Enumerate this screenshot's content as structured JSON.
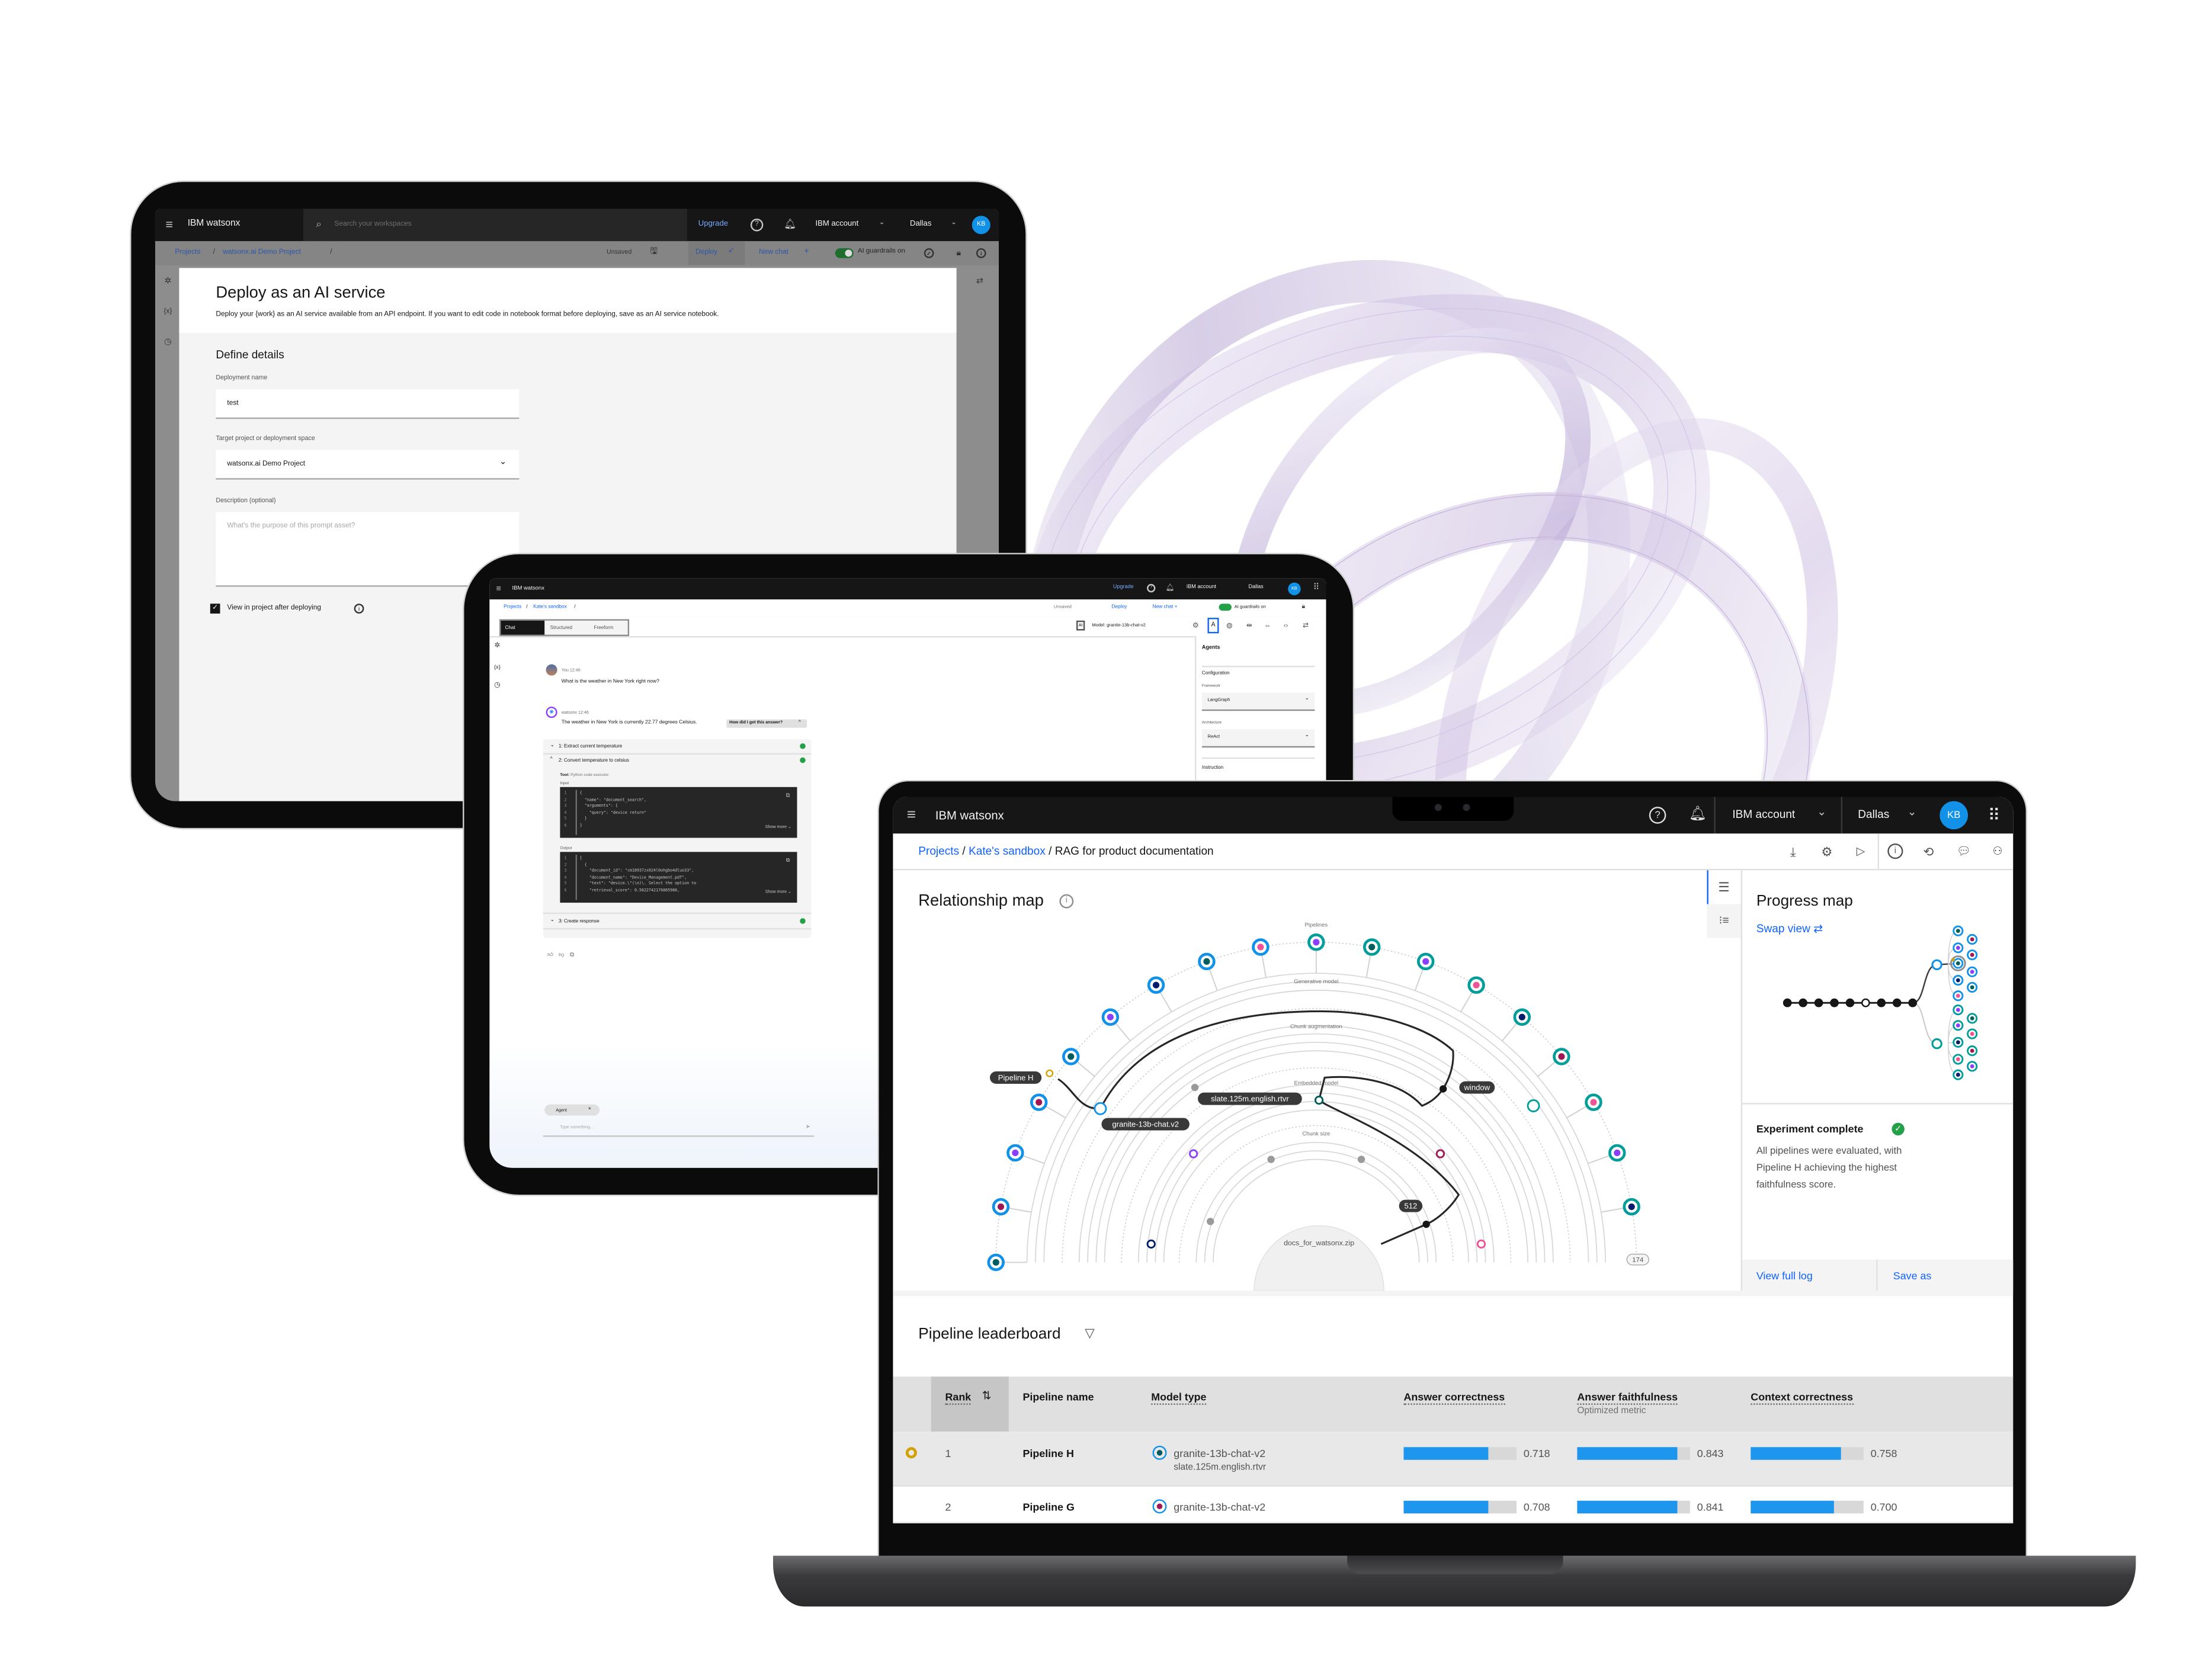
{
  "colors": {
    "brand_blue": "#0f62fe",
    "link_blue": "#0f62fe",
    "accent_blue": "#1192e8",
    "teal": "#009d9a",
    "teal_dark": "#005d5d",
    "magenta_dark": "#9f1853",
    "purple": "#8a3ffc",
    "navy": "#001d6c",
    "pink": "#ee5396",
    "success_green": "#24a148",
    "gold": "#d2a106"
  },
  "tablet_deploy": {
    "header": {
      "app_name": "IBM watsonx",
      "search_placeholder": "Search your workspaces",
      "upgrade": "Upgrade",
      "account": "IBM account",
      "region": "Dallas",
      "avatar": "KB"
    },
    "breadcrumb": [
      "Projects",
      "/",
      "watsonx.ai Demo Project",
      "/"
    ],
    "toolbar": {
      "unsaved": "Unsaved",
      "deploy": "Deploy",
      "new_chat": "New chat",
      "new_chat_plus": "+",
      "guardrails": "AI guardrails on",
      "guardrails_on": true
    },
    "modal": {
      "title": "Deploy as an AI service",
      "description": "Deploy your {work} as an AI service available from an API endpoint. If you want to edit code in notebook format before deploying, save as an AI service notebook.",
      "section": "Define details",
      "deployment_name_label": "Deployment name",
      "deployment_name_value": "test",
      "target_label": "Target project or deployment space",
      "target_value": "watsonx.ai Demo Project",
      "description_label": "Description (optional)",
      "description_placeholder": "What's the purpose of this prompt asset?",
      "checkbox_label": "View in project after deploying",
      "checkbox_checked": true
    }
  },
  "tablet_chat": {
    "header": {
      "app_name": "IBM watsonx",
      "upgrade": "Upgrade",
      "account": "IBM account",
      "region": "Dallas",
      "avatar": "KB"
    },
    "breadcrumb": [
      "Projects",
      "/",
      "Kate's sandbox",
      "/"
    ],
    "toolbar": {
      "unsaved": "Unsaved",
      "deploy": "Deploy",
      "new_chat": "New chat +",
      "guardrails": "AI guardrails on"
    },
    "modes": [
      "Chat",
      "Structured",
      "Freeform"
    ],
    "active_mode": "Chat",
    "model_select": "Model: granite-13b-chat-v2",
    "messages": [
      {
        "author": "You",
        "time": "12:46",
        "text": "What is the weather in New York right now?"
      },
      {
        "author": "watsonx",
        "time": "12:46",
        "text": "The weather in New York is currently 22.77 degrees Celsius.",
        "chip": "How did I get this answer?"
      }
    ],
    "steps": [
      {
        "label": "1: Extract current temperature",
        "status": "complete"
      },
      {
        "label": "2: Convert temperature to celsius",
        "status": "complete"
      },
      {
        "label": "3: Create response",
        "status": "complete"
      }
    ],
    "tool_label": "Tool:",
    "tool_value": "Python code executor",
    "input_label": "Input",
    "output_label": "Output",
    "show_more": "Show more",
    "input_code": [
      "{",
      "  \"name\": \"document_search\",",
      "  \"arguments\": {",
      "    \"query\": \"device return\"",
      "  }",
      "}"
    ],
    "output_code": [
      "[",
      "  {",
      "    \"document_id\": \"cm18937zx024l0ohgbo4dluo33\",",
      "    \"document_name\": \"Device_Management.pdf\",",
      "    \"text\": \"device.\\\"(\\n)\\. Select the option to",
      "    \"retrieval_score\": 0.5622742176865986,"
    ],
    "composer": {
      "chip": "Agent",
      "placeholder": "Type something..."
    },
    "side_panel": {
      "title": "Agents",
      "configuration": "Configuration",
      "framework_label": "Framework",
      "framework_value": "LangGraph",
      "architecture_label": "Architecture",
      "architecture_value": "ReAct",
      "instruction": "Instruction"
    }
  },
  "laptop": {
    "header": {
      "app_name": "IBM watsonx",
      "account": "IBM account",
      "region": "Dallas",
      "avatar": "KB"
    },
    "breadcrumb": [
      "Projects",
      "/",
      "Kate's sandbox",
      "/",
      "RAG for product documentation"
    ],
    "relationship_map": {
      "title": "Relationship map",
      "ring_labels": [
        "Pipelines",
        "Generative model",
        "Chunk augmentation",
        "Embedded model",
        "Chunk size"
      ],
      "source": "docs_for_watsonx.zip",
      "callouts": {
        "pipeline": "Pipeline H",
        "generative_model": "granite-13b-chat.v2",
        "embedding_model": "slate.125m.english.rtvr",
        "chunk_augmentation": "window",
        "chunk_size": "512",
        "overflow_count": "174"
      },
      "pipeline_nodes": [
        {
          "ring": "blue",
          "core": "teal_dark"
        },
        {
          "ring": "blue",
          "core": "magenta_dark"
        },
        {
          "ring": "blue",
          "core": "purple"
        },
        {
          "ring": "blue",
          "core": "magenta_dark"
        },
        {
          "ring": "blue",
          "core": "teal_dark",
          "selected": true
        },
        {
          "ring": "blue",
          "core": "purple"
        },
        {
          "ring": "blue",
          "core": "navy"
        },
        {
          "ring": "blue",
          "core": "teal_dark"
        },
        {
          "ring": "blue",
          "core": "pink"
        },
        {
          "ring": "teal",
          "core": "purple"
        },
        {
          "ring": "teal",
          "core": "teal_dark"
        },
        {
          "ring": "teal",
          "core": "purple"
        },
        {
          "ring": "teal",
          "core": "pink"
        },
        {
          "ring": "teal",
          "core": "navy"
        },
        {
          "ring": "teal",
          "core": "magenta_dark"
        },
        {
          "ring": "teal",
          "core": "pink"
        },
        {
          "ring": "teal",
          "core": "purple"
        },
        {
          "ring": "teal",
          "core": "navy"
        }
      ]
    },
    "progress_map": {
      "title": "Progress map",
      "swap_view": "Swap view",
      "left_column": [
        {
          "ring": "blue",
          "core": "teal_dark"
        },
        {
          "ring": "blue",
          "core": "purple"
        },
        {
          "ring": "blue",
          "core": "teal_dark",
          "selected": true
        },
        {
          "ring": "blue",
          "core": "navy"
        },
        {
          "ring": "blue",
          "core": "pink"
        },
        {
          "ring": "teal",
          "core": "purple"
        },
        {
          "ring": "teal",
          "core": "purple"
        },
        {
          "ring": "teal",
          "core": "navy"
        },
        {
          "ring": "teal",
          "core": "pink"
        },
        {
          "ring": "teal",
          "core": "navy"
        }
      ],
      "right_column": [
        {
          "ring": "blue",
          "core": "magenta_dark"
        },
        {
          "ring": "blue",
          "core": "magenta_dark"
        },
        {
          "ring": "blue",
          "core": "purple"
        },
        {
          "ring": "blue",
          "core": "teal_dark"
        },
        {
          "ring": "teal",
          "core": "teal_dark"
        },
        {
          "ring": "teal",
          "core": "pink"
        },
        {
          "ring": "teal",
          "core": "magenta_dark"
        },
        {
          "ring": "teal",
          "core": "purple"
        }
      ],
      "status_title": "Experiment complete",
      "status_text": [
        "All pipelines were evaluated, with",
        "Pipeline H achieving the highest",
        "faithfulness score."
      ],
      "view_log": "View full log",
      "save_as": "Save as"
    },
    "leaderboard": {
      "title": "Pipeline leaderboard",
      "columns": {
        "rank": "Rank",
        "name": "Pipeline name",
        "model": "Model type",
        "answer_correctness": "Answer correctness",
        "answer_faithfulness": "Answer faithfulness",
        "faithfulness_note": "Optimized metric",
        "context_correctness": "Context correctness"
      },
      "rows": [
        {
          "rank": "1",
          "name": "Pipeline H",
          "model": "granite-13b-chat-v2",
          "embedding": "slate.125m.english.rtvr",
          "model_color": "teal_dark",
          "winner": true,
          "answer_correctness": 0.718,
          "answer_correctness_text": "0.718",
          "answer_faithfulness": 0.843,
          "answer_faithfulness_text": "0.843",
          "context_correctness": 0.758,
          "context_correctness_text": "0.758"
        },
        {
          "rank": "2",
          "name": "Pipeline G",
          "model": "granite-13b-chat-v2",
          "model_color": "magenta_dark",
          "winner": false,
          "answer_correctness": 0.708,
          "answer_correctness_text": "0.708",
          "answer_faithfulness": 0.841,
          "answer_faithfulness_text": "0.841",
          "context_correctness": 0.7,
          "context_correctness_text": "0.700"
        }
      ]
    }
  }
}
